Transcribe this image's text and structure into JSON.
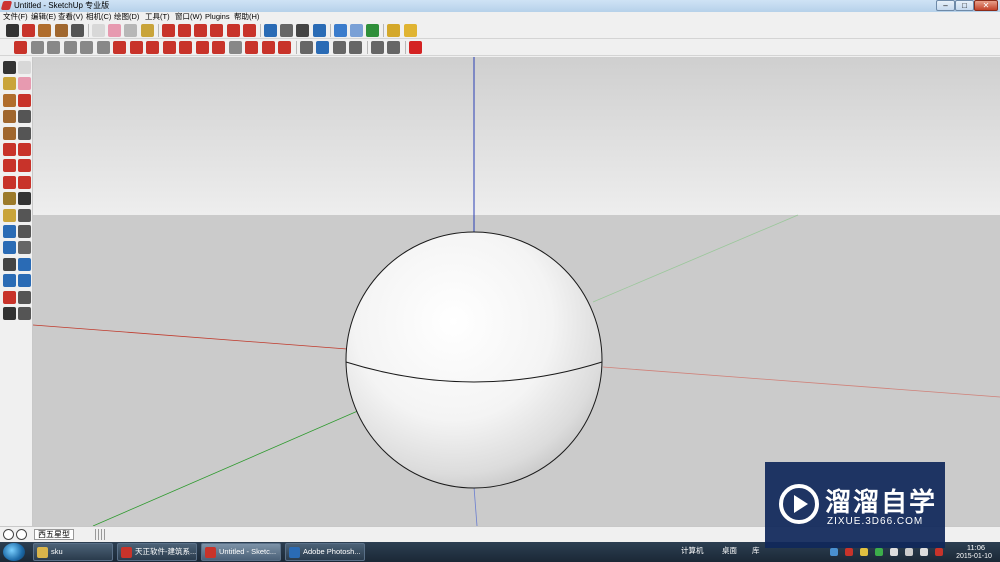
{
  "window": {
    "title": "Untitled - SketchUp 专业版",
    "controls": {
      "minimize": "–",
      "maximize": "□",
      "close": "✕"
    }
  },
  "menu": [
    {
      "label": "文件(F)"
    },
    {
      "label": "编辑(E)"
    },
    {
      "label": "查看(V)"
    },
    {
      "label": "相机(C)"
    },
    {
      "label": "绘图(D)"
    },
    {
      "label": "工具(T)"
    },
    {
      "label": "窗口(W)"
    },
    {
      "label": "Plugins"
    },
    {
      "label": "帮助(H)"
    }
  ],
  "toolbar_top": [
    {
      "icon": "select-arrow-icon",
      "color": "#333333"
    },
    {
      "icon": "pencil-icon",
      "color": "#c8332a"
    },
    {
      "icon": "rectangle-icon",
      "color": "#b06d2c"
    },
    {
      "icon": "circle-icon",
      "color": "#a0672e"
    },
    {
      "icon": "arc-icon",
      "color": "#555555"
    },
    {
      "icon": "make-component-icon",
      "color": "#d8d8d8"
    },
    {
      "icon": "eraser-icon",
      "color": "#e79ab0"
    },
    {
      "icon": "tape-measure-icon",
      "color": "#b7b7b7"
    },
    {
      "icon": "paint-bucket-icon",
      "color": "#c9a43a"
    },
    {
      "icon": "push-pull-icon",
      "color": "#c8332a"
    },
    {
      "icon": "move-icon",
      "color": "#c8332a"
    },
    {
      "icon": "rotate-icon",
      "color": "#c8332a"
    },
    {
      "icon": "follow-me-icon",
      "color": "#c8332a"
    },
    {
      "icon": "scale-icon",
      "color": "#c8332a"
    },
    {
      "icon": "offset-icon",
      "color": "#c8332a"
    },
    {
      "icon": "orbit-icon",
      "color": "#2a6bb5"
    },
    {
      "icon": "pan-icon",
      "color": "#666666"
    },
    {
      "icon": "zoom-icon",
      "color": "#444444"
    },
    {
      "icon": "zoom-extents-icon",
      "color": "#2a6bb5"
    },
    {
      "icon": "3d-warehouse-icon",
      "color": "#3b7ccc"
    },
    {
      "icon": "share-model-icon",
      "color": "#7aa0d6"
    },
    {
      "icon": "get-components-icon",
      "color": "#2f8f3a"
    },
    {
      "icon": "extension-icon",
      "color": "#d4a82a"
    },
    {
      "icon": "layout-icon",
      "color": "#e0b432"
    }
  ],
  "toolbar_second": [
    {
      "icon": "section-plane-icon",
      "color": "#c8332a"
    },
    {
      "icon": "wall-tool-icon",
      "color": "#888888"
    },
    {
      "icon": "box-icon",
      "color": "#888888"
    },
    {
      "icon": "stairs-icon",
      "color": "#888888"
    },
    {
      "icon": "railing-icon",
      "color": "#888888"
    },
    {
      "icon": "roof-icon",
      "color": "#888888"
    },
    {
      "icon": "door-icon",
      "color": "#c8332a"
    },
    {
      "icon": "window-icon",
      "color": "#c8332a"
    },
    {
      "icon": "slab-icon",
      "color": "#c8332a"
    },
    {
      "icon": "line-tool-icon",
      "color": "#c8332a"
    },
    {
      "icon": "plank-icon",
      "color": "#c8332a"
    },
    {
      "icon": "curve-icon",
      "color": "#c8332a"
    },
    {
      "icon": "trim-icon",
      "color": "#c8332a"
    },
    {
      "icon": "curved-surface-icon",
      "color": "#888888"
    },
    {
      "icon": "fillet-icon",
      "color": "#c8332a"
    },
    {
      "icon": "angle-icon",
      "color": "#c8332a"
    },
    {
      "icon": "weld-icon",
      "color": "#c8332a"
    },
    {
      "icon": "walk-icon",
      "color": "#666666"
    },
    {
      "icon": "dimension-icon",
      "color": "#2a6bb5"
    },
    {
      "icon": "text-icon",
      "color": "#666666"
    },
    {
      "icon": "grid-icon",
      "color": "#666666"
    },
    {
      "icon": "array-icon",
      "color": "#666666"
    },
    {
      "icon": "explode-icon",
      "color": "#666666"
    },
    {
      "icon": "su-plugin-icon",
      "color": "#d42222"
    }
  ],
  "left_toolbar": [
    {
      "icon": "select-icon",
      "color": "#333333"
    },
    {
      "icon": "component-icon",
      "color": "#d8d8d8"
    },
    {
      "icon": "paint-icon",
      "color": "#c9a43a"
    },
    {
      "icon": "erase-icon",
      "color": "#e79ab0"
    },
    {
      "icon": "rect-icon",
      "color": "#b06d2c"
    },
    {
      "icon": "line-icon",
      "color": "#c8332a"
    },
    {
      "icon": "circle-tool-icon",
      "color": "#a0672e"
    },
    {
      "icon": "arc-tool-icon",
      "color": "#555555"
    },
    {
      "icon": "polygon-icon",
      "color": "#a0672e"
    },
    {
      "icon": "freehand-icon",
      "color": "#555555"
    },
    {
      "icon": "move-tool-icon",
      "color": "#c8332a"
    },
    {
      "icon": "pushpull-tool-icon",
      "color": "#c8332a"
    },
    {
      "icon": "rotate-tool-icon",
      "color": "#c8332a"
    },
    {
      "icon": "followme-tool-icon",
      "color": "#c8332a"
    },
    {
      "icon": "scale-tool-icon",
      "color": "#c8332a"
    },
    {
      "icon": "offset-tool-icon",
      "color": "#c8332a"
    },
    {
      "icon": "tape-icon",
      "color": "#9c7a2a"
    },
    {
      "icon": "dimension-tool-icon",
      "color": "#333333"
    },
    {
      "icon": "protractor-icon",
      "color": "#c9a43a"
    },
    {
      "icon": "text-tool-icon",
      "color": "#555555"
    },
    {
      "icon": "axes-icon",
      "color": "#2a6bb5"
    },
    {
      "icon": "3d-text-icon",
      "color": "#555555"
    },
    {
      "icon": "orbit-tool-icon",
      "color": "#2a6bb5"
    },
    {
      "icon": "pan-tool-icon",
      "color": "#666666"
    },
    {
      "icon": "zoom-tool-icon",
      "color": "#444444"
    },
    {
      "icon": "zoom-window-icon",
      "color": "#2a6bb5"
    },
    {
      "icon": "previous-view-icon",
      "color": "#2a6bb5"
    },
    {
      "icon": "next-view-icon",
      "color": "#2a6bb5"
    },
    {
      "icon": "position-camera-icon",
      "color": "#c8332a"
    },
    {
      "icon": "look-around-icon",
      "color": "#555555"
    },
    {
      "icon": "walk-tool-icon",
      "color": "#333333"
    },
    {
      "icon": "section-tool-icon",
      "color": "#555555"
    }
  ],
  "viewport": {
    "sky_top": "#cfcfcf",
    "sky_bottom": "#eeeeee",
    "ground": "#cbcbcb",
    "axis_colors": {
      "red": "#c0392b",
      "green": "#2e9a2e",
      "blue": "#2a3fb5"
    }
  },
  "statusbar": {
    "measure_label": "西五星型",
    "icons": [
      "info-icon",
      "user-icon",
      "question-icon"
    ]
  },
  "taskbar": {
    "items": [
      {
        "label": "sku",
        "icon_color": "#d9b44a"
      },
      {
        "label": "天正软件-建筑系...",
        "icon_color": "#c8332a"
      },
      {
        "label": "Untitled - Sketc...",
        "icon_color": "#c8332a",
        "active": true
      },
      {
        "label": "Adobe Photosh...",
        "icon_color": "#2a6bb5"
      }
    ],
    "tray_label": "计算机",
    "tray_desktop": "桌面",
    "tray_library": "库",
    "time": "11:06",
    "date": "2015-01-10"
  },
  "watermark": {
    "title": "溜溜自学",
    "url": "ZIXUE.3D66.COM"
  }
}
